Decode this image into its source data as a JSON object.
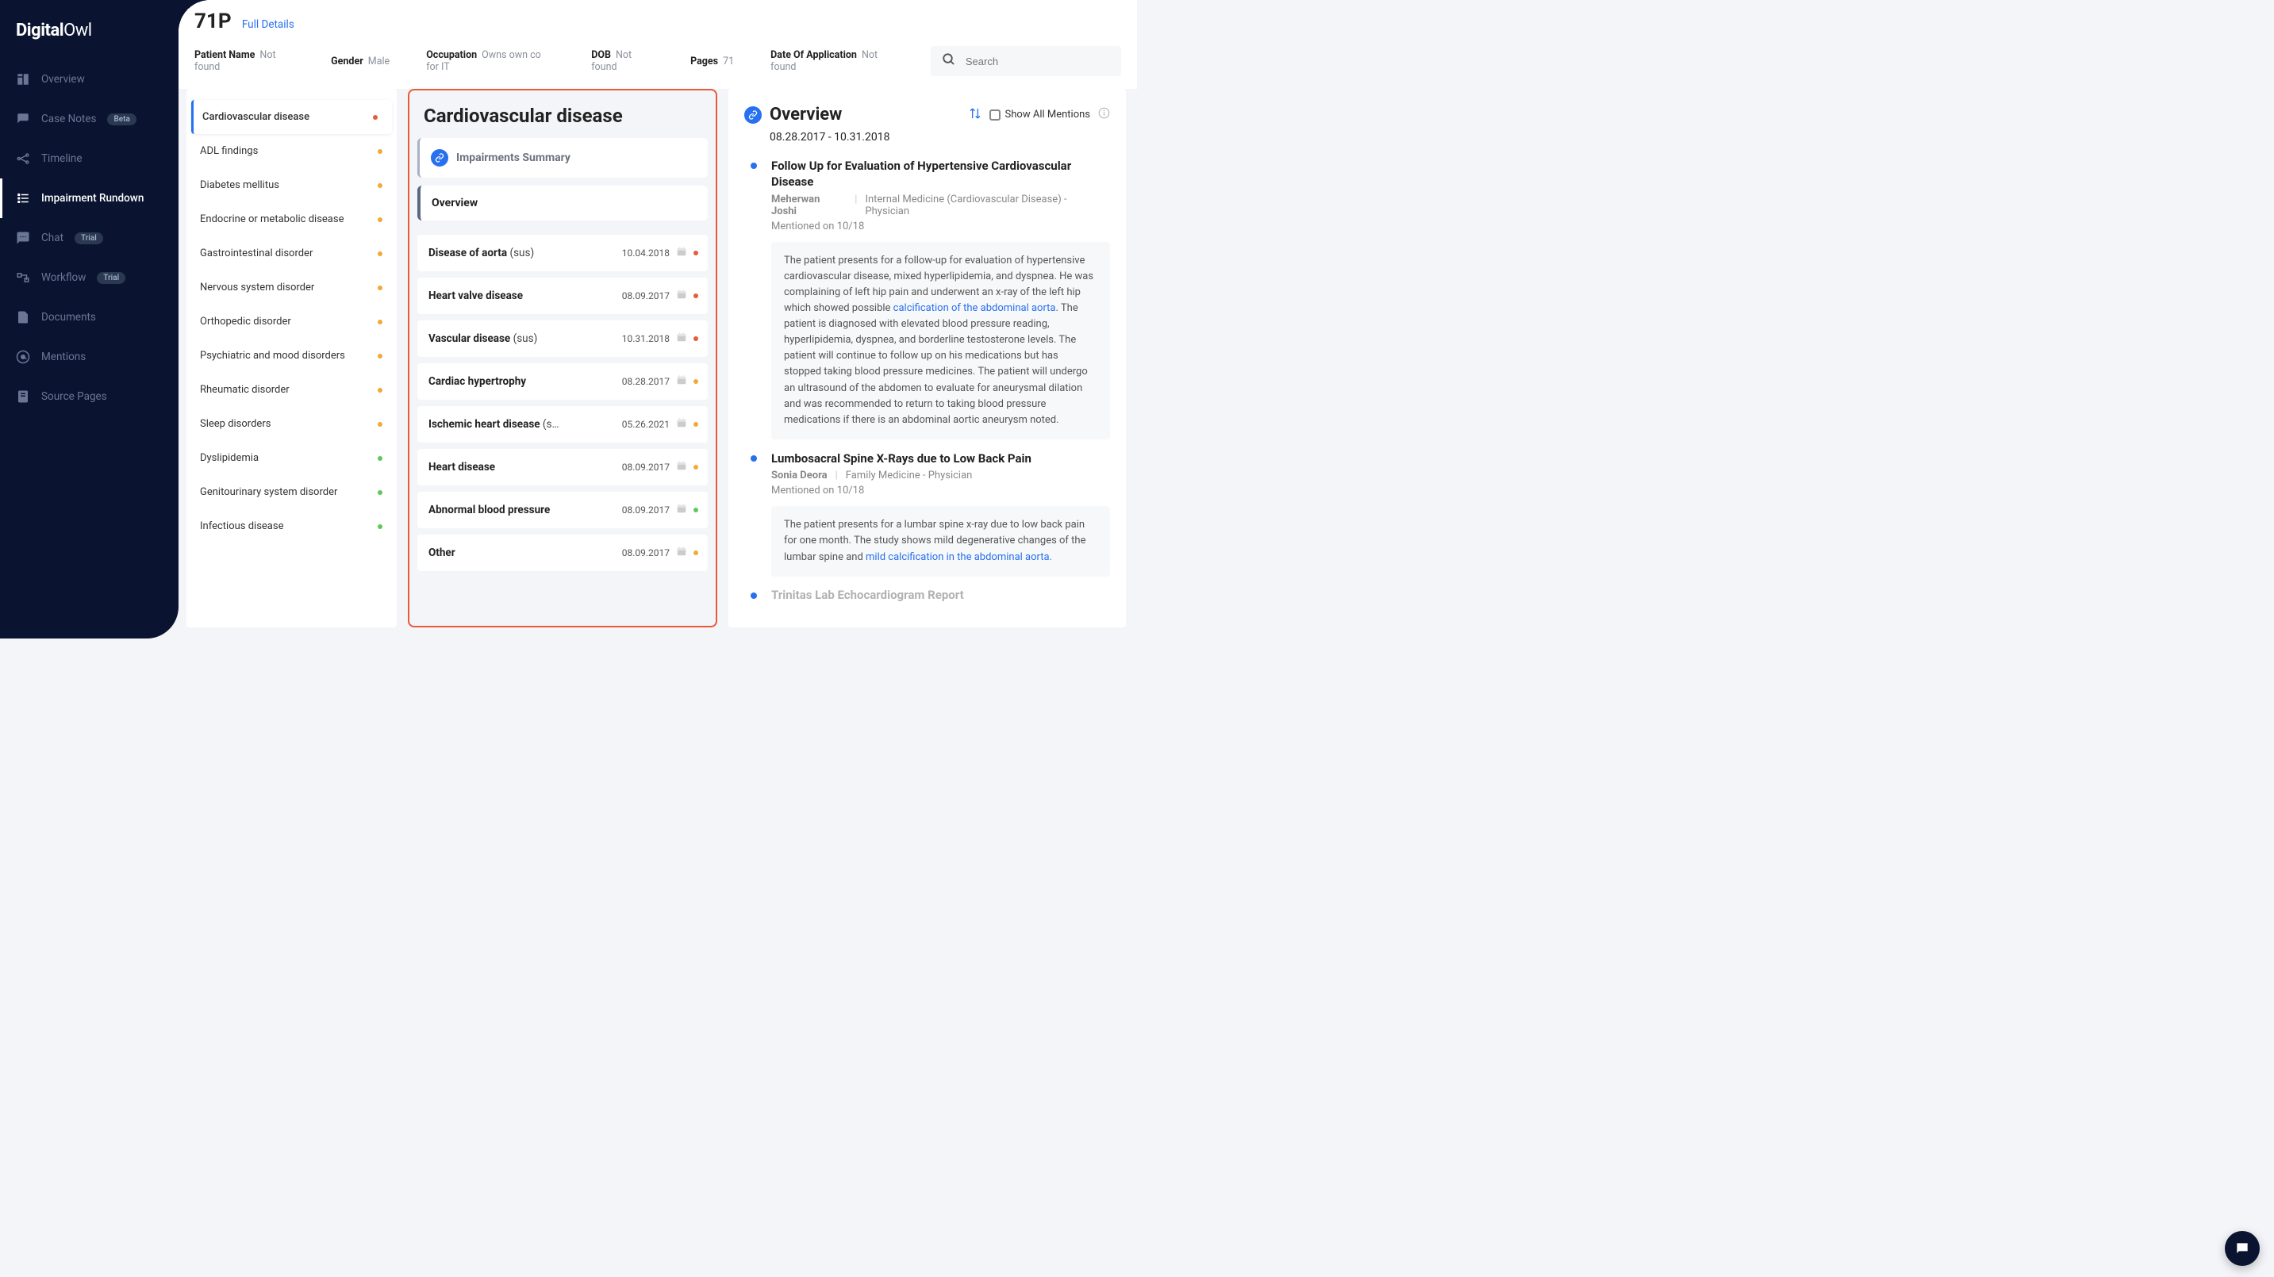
{
  "brand": {
    "part1": "Digital",
    "part2": "Owl"
  },
  "sidebar": {
    "items": [
      {
        "label": "Overview"
      },
      {
        "label": "Case Notes",
        "badge": "Beta"
      },
      {
        "label": "Timeline"
      },
      {
        "label": "Impairment Rundown",
        "active": true
      },
      {
        "label": "Chat",
        "badge": "Trial"
      },
      {
        "label": "Workflow",
        "badge": "Trial"
      },
      {
        "label": "Documents"
      },
      {
        "label": "Mentions"
      },
      {
        "label": "Source Pages"
      }
    ]
  },
  "header": {
    "case_id": "71P",
    "full_details": "Full Details",
    "meta": [
      {
        "label": "Patient Name",
        "value": "Not found"
      },
      {
        "label": "Gender",
        "value": "Male"
      },
      {
        "label": "Occupation",
        "value": "Owns own co for IT"
      },
      {
        "label": "DOB",
        "value": "Not found"
      },
      {
        "label": "Pages",
        "value": "71"
      },
      {
        "label": "Date Of Application",
        "value": "Not found"
      }
    ],
    "search_placeholder": "Search"
  },
  "categories": [
    {
      "name": "Cardiovascular disease",
      "dot": "red",
      "active": true
    },
    {
      "name": "ADL findings",
      "dot": "orange"
    },
    {
      "name": "Diabetes mellitus",
      "dot": "orange"
    },
    {
      "name": "Endocrine or metabolic disease",
      "dot": "orange"
    },
    {
      "name": "Gastrointestinal disorder",
      "dot": "orange"
    },
    {
      "name": "Nervous system disorder",
      "dot": "orange"
    },
    {
      "name": "Orthopedic disorder",
      "dot": "orange"
    },
    {
      "name": "Psychiatric and mood disorders",
      "dot": "orange"
    },
    {
      "name": "Rheumatic disorder",
      "dot": "orange"
    },
    {
      "name": "Sleep disorders",
      "dot": "orange"
    },
    {
      "name": "Dyslipidemia",
      "dot": "green"
    },
    {
      "name": "Genitourinary system disorder",
      "dot": "green"
    },
    {
      "name": "Infectious disease",
      "dot": "green"
    }
  ],
  "panel": {
    "title": "Cardiovascular disease",
    "summary_label": "Impairments Summary",
    "overview_label": "Overview",
    "entities": [
      {
        "name": "Disease of aorta",
        "sus": "(sus)",
        "date": "10.04.2018",
        "dot": "red"
      },
      {
        "name": "Heart valve disease",
        "sus": "",
        "date": "08.09.2017",
        "dot": "red"
      },
      {
        "name": "Vascular disease",
        "sus": "(sus)",
        "date": "10.31.2018",
        "dot": "red"
      },
      {
        "name": "Cardiac hypertrophy",
        "sus": "",
        "date": "08.28.2017",
        "dot": "orange"
      },
      {
        "name": "Ischemic heart disease",
        "sus": "(s…",
        "date": "05.26.2021",
        "dot": "orange"
      },
      {
        "name": "Heart disease",
        "sus": "",
        "date": "08.09.2017",
        "dot": "orange"
      },
      {
        "name": "Abnormal blood pressure",
        "sus": "",
        "date": "08.09.2017",
        "dot": "green"
      },
      {
        "name": "Other",
        "sus": "",
        "date": "08.09.2017",
        "dot": "orange"
      }
    ]
  },
  "detail": {
    "title": "Overview",
    "show_all": "Show All Mentions",
    "date_range": "08.28.2017 - 10.31.2018",
    "events": [
      {
        "title": "Follow Up for Evaluation of Hypertensive Cardiovascular Disease",
        "author": "Meherwan Joshi",
        "role": "Internal Medicine (Cardiovascular Disease) - Physician",
        "mentioned": "Mentioned on 10/18",
        "text_before": "The patient presents for a follow-up for evaluation of hypertensive cardiovascular disease, mixed hyperlipidemia, and dyspnea. He was complaining of left hip pain and underwent an x-ray of the left hip which showed possible ",
        "link": "calcification of the abdominal aorta",
        "text_after": ". The patient is diagnosed with elevated blood pressure reading, hyperlipidemia, dyspnea, and borderline testosterone levels. The patient will continue to follow up on his medications but has stopped taking blood pressure medicines. The patient will undergo an ultrasound of the abdomen to evaluate for aneurysmal dilation and was recommended to return to taking blood pressure medications if there is an abdominal aortic aneurysm noted."
      },
      {
        "title": "Lumbosacral Spine X-Rays due to Low Back Pain",
        "author": "Sonia Deora",
        "role": "Family Medicine - Physician",
        "mentioned": "Mentioned on 10/18",
        "text_before": "The patient presents for a lumbar spine x-ray due to low back pain for one month. The study shows mild degenerative changes of the lumbar spine and ",
        "link": "mild calcification in the abdominal aorta.",
        "text_after": ""
      }
    ],
    "cutoff": "Trinitas Lab Echocardiogram Report"
  }
}
